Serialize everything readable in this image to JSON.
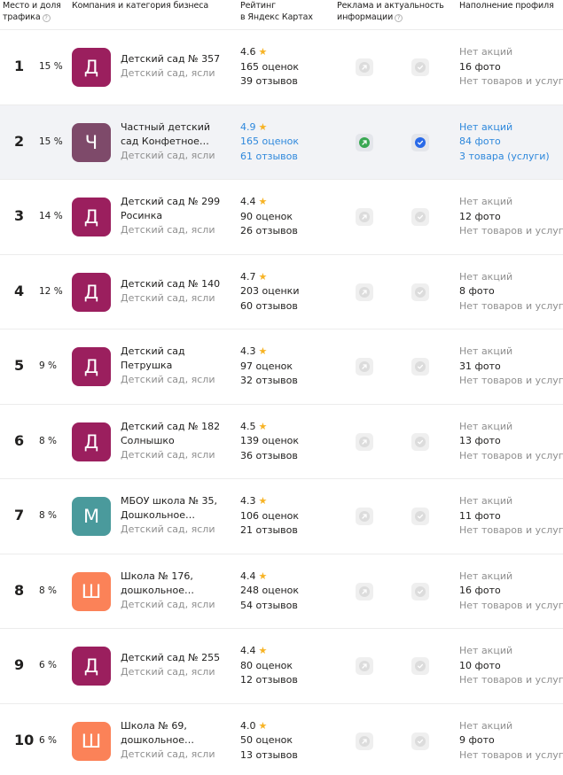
{
  "header": {
    "col_rank": [
      "Место и доля",
      "трафика"
    ],
    "col_company": "Компания и категория бизнеса",
    "col_rating": [
      "Рейтинг",
      "в Яндекс Картах"
    ],
    "col_ads": [
      "Реклама и актуальность",
      "информации"
    ],
    "col_profile": "Наполнение профиля",
    "help_glyph": "?"
  },
  "colors": {
    "avatar_d": "#9b1f5e",
    "avatar_ch": "#7e4a6a",
    "avatar_m": "#4a9a9c",
    "avatar_sh": "#fb8258",
    "link_blue": "#2e88dc",
    "star": "#f7b324"
  },
  "rows": [
    {
      "rank": "1",
      "share": "15 %",
      "letter": "Д",
      "avatar_color": "#9b1f5e",
      "name": [
        "Детский сад № 357"
      ],
      "category": "Детский сад, ясли",
      "rating": "4.6",
      "ratings_count": "165 оценок",
      "reviews": "39 отзывов",
      "promo": "Нет акций",
      "photos": "16 фото",
      "goods": "Нет товаров и услуг",
      "active": false
    },
    {
      "rank": "2",
      "share": "15 %",
      "letter": "Ч",
      "avatar_color": "#7e4a6a",
      "name": [
        "Частный детский",
        "сад Конфетное…"
      ],
      "category": "Детский сад, ясли",
      "rating": "4.9",
      "ratings_count": "165 оценок",
      "reviews": "61 отзывов",
      "promo": "Нет акций",
      "photos": "84 фото",
      "goods": "3 товара (услуги)",
      "active": true
    },
    {
      "rank": "3",
      "share": "14 %",
      "letter": "Д",
      "avatar_color": "#9b1f5e",
      "name": [
        "Детский сад № 299",
        "Росинка"
      ],
      "category": "Детский сад, ясли",
      "rating": "4.4",
      "ratings_count": "90 оценок",
      "reviews": "26 отзывов",
      "promo": "Нет акций",
      "photos": "12 фото",
      "goods": "Нет товаров и услуг",
      "active": false
    },
    {
      "rank": "4",
      "share": "12 %",
      "letter": "Д",
      "avatar_color": "#9b1f5e",
      "name": [
        "Детский сад № 140"
      ],
      "category": "Детский сад, ясли",
      "rating": "4.7",
      "ratings_count": "203 оценки",
      "reviews": "60 отзывов",
      "promo": "Нет акций",
      "photos": "8 фото",
      "goods": "Нет товаров и услуг",
      "active": false
    },
    {
      "rank": "5",
      "share": "9 %",
      "letter": "Д",
      "avatar_color": "#9b1f5e",
      "name": [
        "Детский сад",
        "Петрушка"
      ],
      "category": "Детский сад, ясли",
      "rating": "4.3",
      "ratings_count": "97 оценок",
      "reviews": "32 отзывов",
      "promo": "Нет акций",
      "photos": "31 фото",
      "goods": "Нет товаров и услуг",
      "active": false
    },
    {
      "rank": "6",
      "share": "8 %",
      "letter": "Д",
      "avatar_color": "#9b1f5e",
      "name": [
        "Детский сад № 182",
        "Солнышко"
      ],
      "category": "Детский сад, ясли",
      "rating": "4.5",
      "ratings_count": "139 оценок",
      "reviews": "36 отзывов",
      "promo": "Нет акций",
      "photos": "13 фото",
      "goods": "Нет товаров и услуг",
      "active": false
    },
    {
      "rank": "7",
      "share": "8 %",
      "letter": "М",
      "avatar_color": "#4a9a9c",
      "name": [
        "МБОУ школа № 35,",
        "Дошкольное…"
      ],
      "category": "Детский сад, ясли",
      "rating": "4.3",
      "ratings_count": "106 оценок",
      "reviews": "21 отзывов",
      "promo": "Нет акций",
      "photos": "11 фото",
      "goods": "Нет товаров и услуг",
      "active": false
    },
    {
      "rank": "8",
      "share": "8 %",
      "letter": "Ш",
      "avatar_color": "#fb8258",
      "name": [
        "Школа № 176,",
        "дошкольное…"
      ],
      "category": "Детский сад, ясли",
      "rating": "4.4",
      "ratings_count": "248 оценок",
      "reviews": "54 отзывов",
      "promo": "Нет акций",
      "photos": "16 фото",
      "goods": "Нет товаров и услуг",
      "active": false
    },
    {
      "rank": "9",
      "share": "6 %",
      "letter": "Д",
      "avatar_color": "#9b1f5e",
      "name": [
        "Детский сад № 255"
      ],
      "category": "Детский сад, ясли",
      "rating": "4.4",
      "ratings_count": "80 оценок",
      "reviews": "12 отзывов",
      "promo": "Нет акций",
      "photos": "10 фото",
      "goods": "Нет товаров и услуг",
      "active": false
    },
    {
      "rank": "10",
      "share": "6 %",
      "letter": "Ш",
      "avatar_color": "#fb8258",
      "name": [
        "Школа № 69,",
        "дошкольное…"
      ],
      "category": "Детский сад, ясли",
      "rating": "4.0",
      "ratings_count": "50 оценок",
      "reviews": "13 отзывов",
      "promo": "Нет акций",
      "photos": "9 фото",
      "goods": "Нет товаров и услуг",
      "active": false
    }
  ]
}
